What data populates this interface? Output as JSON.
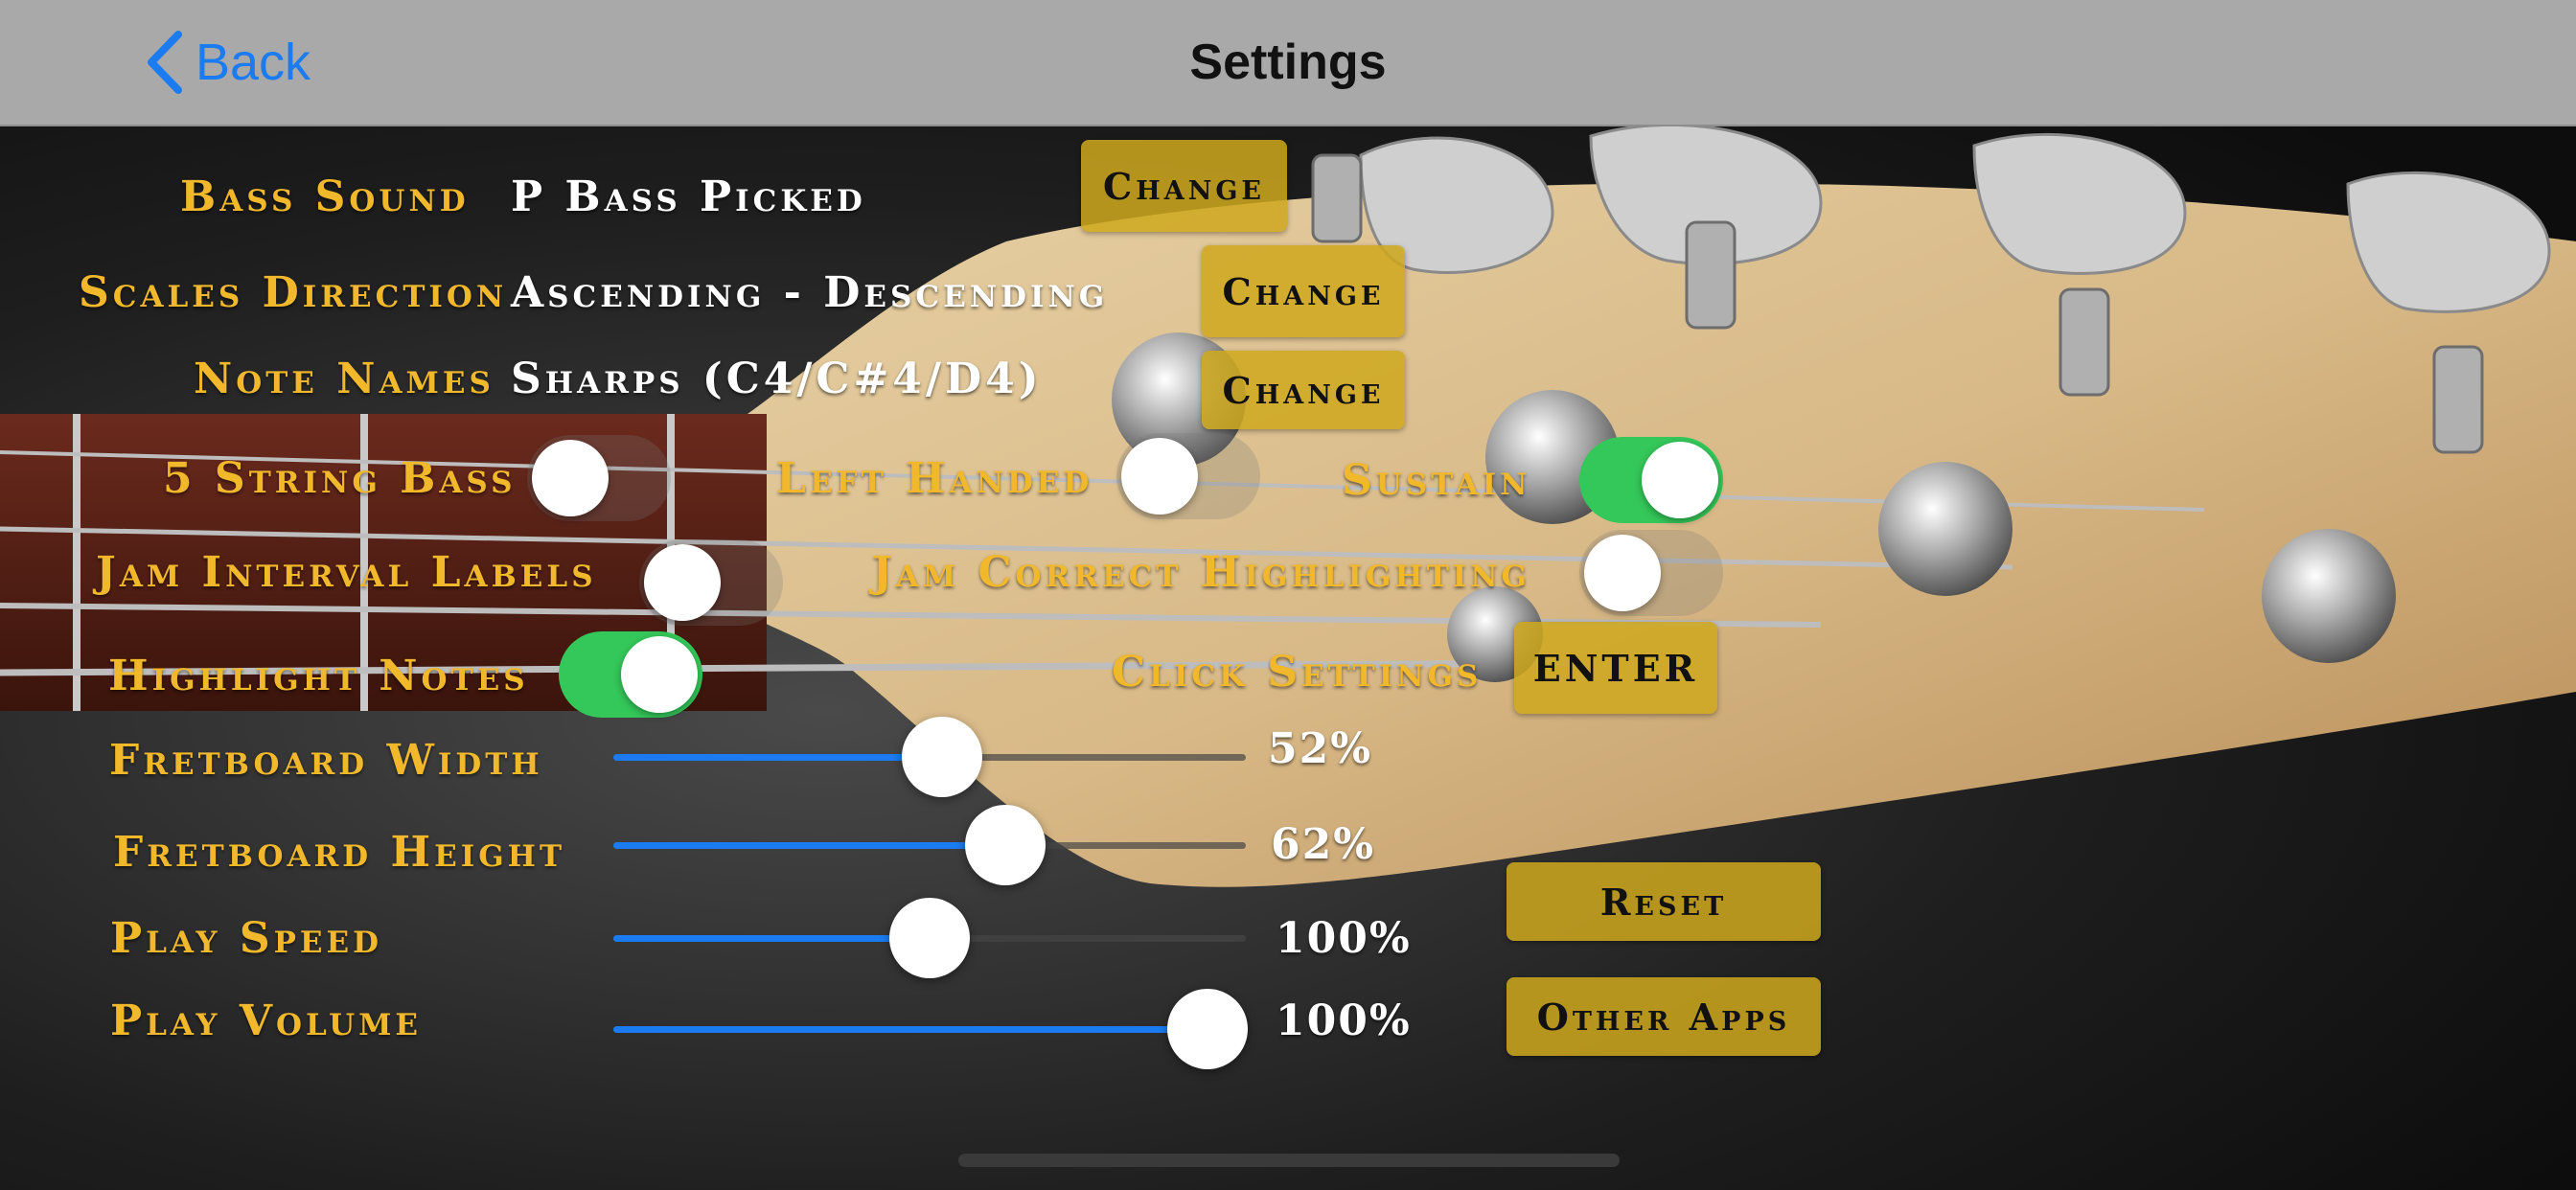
{
  "nav": {
    "back_label": "Back",
    "title": "Settings"
  },
  "rows": {
    "bass_sound": {
      "label": "Bass Sound",
      "value": "P Bass Picked",
      "button": "Change"
    },
    "scales_direction": {
      "label": "Scales Direction",
      "value": "Ascending - Descending",
      "button": "Change"
    },
    "note_names": {
      "label": "Note Names",
      "value": "Sharps (C4/C#4/D4)",
      "button": "Change"
    }
  },
  "toggles": {
    "five_string": {
      "label": "5 String Bass",
      "on": false
    },
    "left_handed": {
      "label": "Left Handed",
      "on": false
    },
    "sustain": {
      "label": "Sustain",
      "on": true
    },
    "jam_interval": {
      "label": "Jam Interval Labels",
      "on": false
    },
    "jam_correct": {
      "label": "Jam Correct Highlighting",
      "on": false
    },
    "highlight_notes": {
      "label": "Highlight Notes",
      "on": true
    }
  },
  "click_settings": {
    "label": "Click Settings",
    "button": "ENTER"
  },
  "sliders": {
    "fretboard_width": {
      "label": "Fretboard Width",
      "value": 0.52,
      "display": "52%"
    },
    "fretboard_height": {
      "label": "Fretboard Height",
      "value": 0.62,
      "display": "62%"
    },
    "play_speed": {
      "label": "Play Speed",
      "value": 0.5,
      "display": "100%"
    },
    "play_volume": {
      "label": "Play Volume",
      "value": 1.0,
      "display": "100%"
    }
  },
  "buttons": {
    "reset": "Reset",
    "other_apps": "Other Apps"
  },
  "colors": {
    "label_gold": "#f1b82c",
    "button_gold": "#cea81e",
    "toggle_on": "#34c759",
    "accent_blue": "#1a7cf0",
    "nav_bar": "#a9a9a9"
  }
}
